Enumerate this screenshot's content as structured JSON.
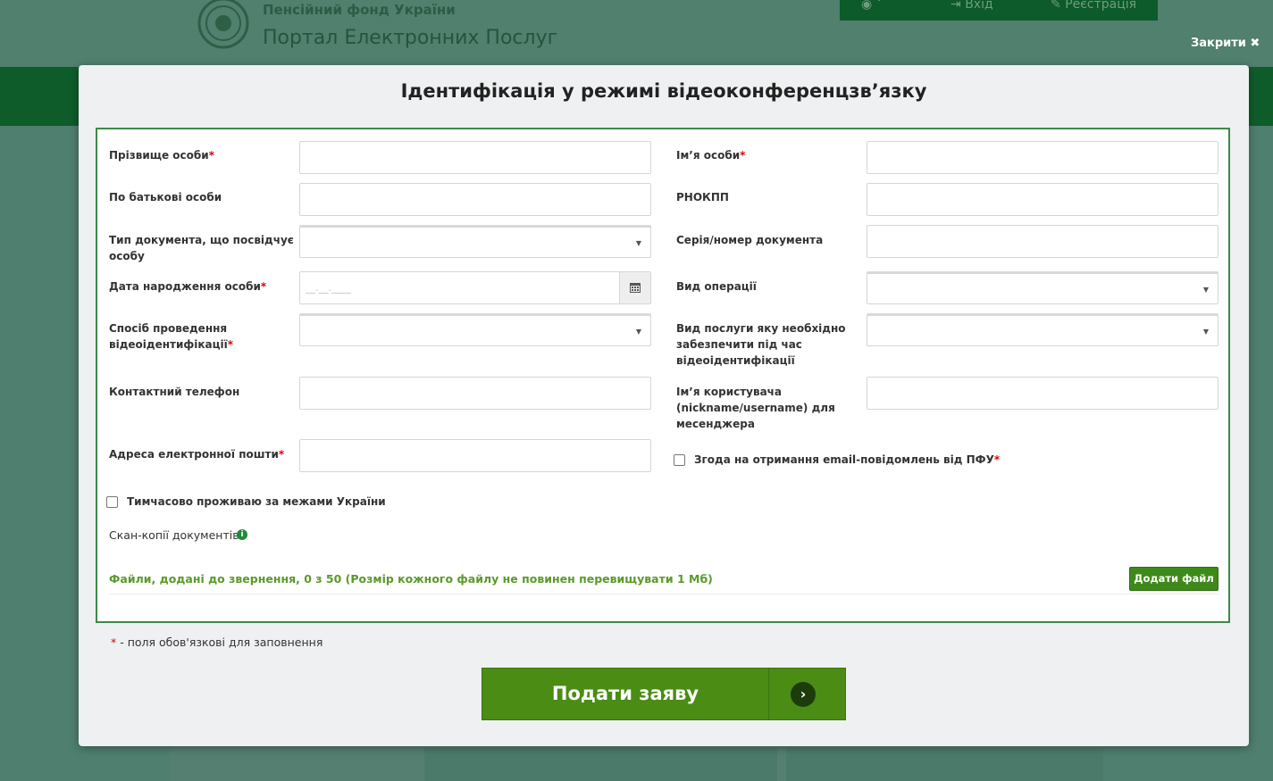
{
  "background": {
    "org_name": "Пенсійний фонд України",
    "portal_name": "Портал Електронних Послуг",
    "nav": {
      "login": "Вхід",
      "register": "Реєстрація"
    },
    "close_label": "Закрити ✖"
  },
  "modal": {
    "title": "Ідентифікація у режимі відеоконференцзв’язку",
    "fields": {
      "surname": {
        "label": "Прізвище особи",
        "required": "*",
        "value": ""
      },
      "first_name": {
        "label": "Ім’я особи",
        "required": "*",
        "value": ""
      },
      "patronymic": {
        "label": "По батькові особи",
        "value": ""
      },
      "rnokpp": {
        "label": "РНОКПП",
        "value": ""
      },
      "doc_type": {
        "label_line1": "Тип документа, що посвідчує",
        "label_line2": "особу",
        "value": ""
      },
      "doc_number": {
        "label": "Серія/номер документа",
        "value": ""
      },
      "birth_date": {
        "label": "Дата народження особи",
        "required": "*",
        "placeholder": "__.__.____"
      },
      "operation_type": {
        "label": "Вид операції",
        "value": ""
      },
      "video_method": {
        "label_line1": "Спосіб проведення",
        "label_line2": "відеоідентифікації",
        "required": "*",
        "value": ""
      },
      "service_type": {
        "label_line1": "Вид послуги яку необхідно",
        "label_line2": "забезпечити під час",
        "label_line3": "відеоідентифікації",
        "value": ""
      },
      "phone": {
        "label": "Контактний телефон",
        "value": ""
      },
      "messenger_username": {
        "label_line1": "Ім’я користувача",
        "label_line2": "(nickname/username) для",
        "label_line3": "месенджера",
        "value": ""
      },
      "email": {
        "label": "Адреса електронної пошти",
        "required": "*",
        "value": ""
      }
    },
    "email_consent": {
      "label": "Згода на отримання email-повідомлень від ПФУ",
      "required": "*",
      "checked": false
    },
    "abroad": {
      "label": "Тимчасово проживаю за межами України",
      "checked": false
    },
    "scan_copies_label": "Скан-копії документів",
    "info_icon_glyph": "i",
    "files_info": "Файли, додані до звернення, 0 з 50 (Розмір кожного файлу не повинен перевищувати 1 Мб)",
    "add_file_button": "Додати файл ▾",
    "required_note_star": "*",
    "required_note": " - поля обов'язкові для заповнення",
    "submit_button": "Подати заяву",
    "submit_arrow": "›"
  },
  "colors": {
    "accent_green": "#4a8c14",
    "border_green": "#3c8a45",
    "required_red": "#d9000d",
    "files_text_green": "#5a9a2a"
  }
}
